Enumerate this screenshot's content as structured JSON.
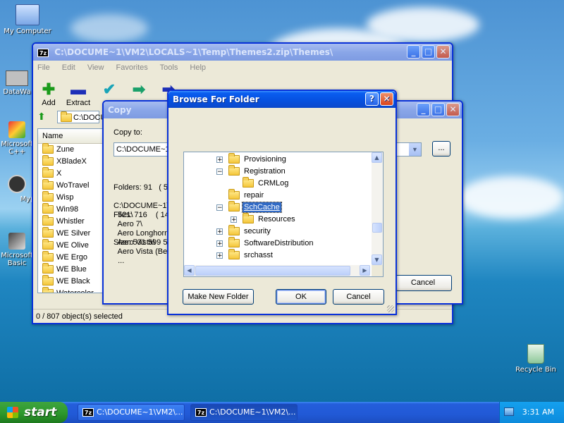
{
  "desktop": {
    "icons": [
      {
        "label": "My Computer"
      },
      {
        "label": "DataWa"
      },
      {
        "label": "Microsoft C++"
      },
      {
        "label": "Myp"
      },
      {
        "label": "Microsoft Basic"
      },
      {
        "label": "Recycle Bin"
      }
    ]
  },
  "main_window": {
    "title": "C:\\DOCUME~1\\VM2\\LOCALS~1\\Temp\\Themes2.zip\\Themes\\",
    "menu": [
      "File",
      "Edit",
      "View",
      "Favorites",
      "Tools",
      "Help"
    ],
    "toolbar": [
      {
        "label": "Add",
        "icon": "add-icon"
      },
      {
        "label": "Extract",
        "icon": "extract-icon"
      },
      {
        "label": "",
        "icon": "test-icon"
      },
      {
        "label": "",
        "icon": "copy-icon"
      },
      {
        "label": "",
        "icon": "move-icon"
      },
      {
        "label": "",
        "icon": "delete-icon"
      },
      {
        "label": "",
        "icon": "info-icon"
      }
    ],
    "address": "C:\\DOCU",
    "column_name": "Name",
    "files": [
      "Zune",
      "XBladeX",
      "X",
      "WoTravel",
      "Wisp",
      "Win98",
      "Whistler",
      "WE Silver",
      "WE Olive",
      "WE Ergo",
      "WE Blue",
      "WE Black",
      "Watercolor"
    ],
    "status": "0 / 807 object(s) selected"
  },
  "copy_window": {
    "title": "Copy",
    "copy_to_label": "Copy to:",
    "copy_to_value": "C:\\DOCUME~1",
    "folders": "Folders: 91   ( 5",
    "files": "Files: 716    ( 14",
    "size": "Size: 531 599 57",
    "paths": [
      "C:\\DOCUME~1\\",
      "  521\\",
      "  Aero 7\\",
      "  Aero Longhorn",
      "  Aero Vista\\",
      "  Aero Vista (Bet",
      "  ..."
    ],
    "browse_label": "...",
    "cancel_label": "Cancel"
  },
  "browse_dialog": {
    "title": "Browse For Folder",
    "tree": [
      {
        "label": "Provisioning",
        "indent": 0,
        "expander": "+"
      },
      {
        "label": "Registration",
        "indent": 0,
        "expander": "−"
      },
      {
        "label": "CRMLog",
        "indent": 1,
        "expander": ""
      },
      {
        "label": "repair",
        "indent": 0,
        "expander": ""
      },
      {
        "label": "SchCache",
        "indent": 0,
        "expander": "−",
        "selected": true
      },
      {
        "label": "Resources",
        "indent": 1,
        "expander": "+"
      },
      {
        "label": "security",
        "indent": 0,
        "expander": "+"
      },
      {
        "label": "SoftwareDistribution",
        "indent": 0,
        "expander": "+"
      },
      {
        "label": "srchasst",
        "indent": 0,
        "expander": "+"
      }
    ],
    "make_new_folder_label": "Make New Folder",
    "ok_label": "OK",
    "cancel_label": "Cancel"
  },
  "taskbar": {
    "start_label": "start",
    "tasks": [
      "C:\\DOCUME~1\\VM2\\...",
      "C:\\DOCUME~1\\VM2\\..."
    ],
    "clock": "3:31 AM"
  },
  "colors": {
    "xp_blue": "#0a5ef0",
    "selection": "#316ac5",
    "window_face": "#ece9d8"
  }
}
